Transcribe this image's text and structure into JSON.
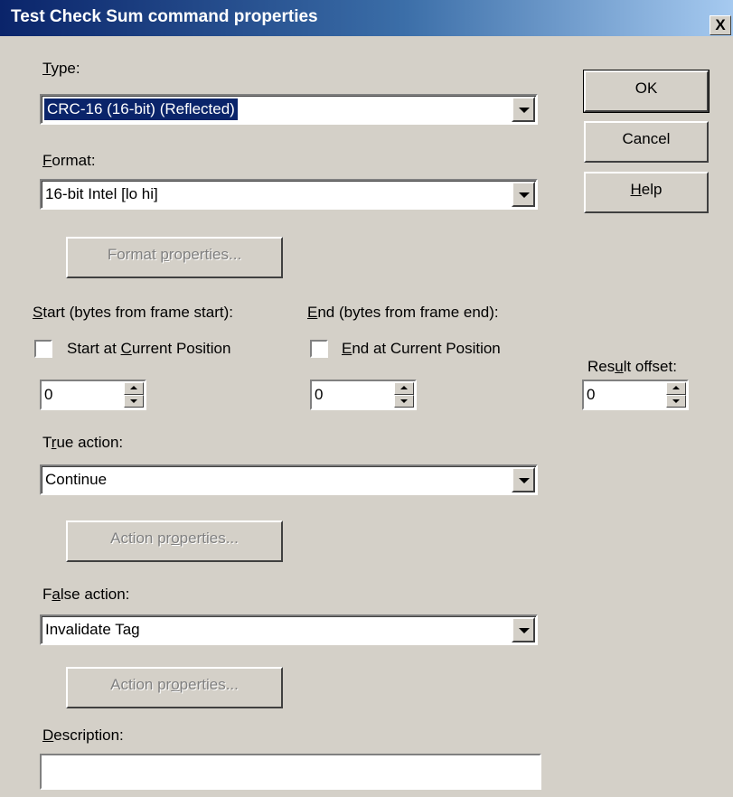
{
  "window": {
    "title": "Test Check Sum command properties",
    "close_label": "X"
  },
  "type": {
    "label_u": "T",
    "label_rest": "ype:",
    "value": "CRC-16  (16-bit) (Reflected)"
  },
  "format": {
    "label_u": "F",
    "label_rest": "ormat:",
    "value": "16-bit Intel  [lo hi]"
  },
  "format_properties": {
    "pre": "Format ",
    "u": "p",
    "post": "roperties..."
  },
  "start": {
    "label_u": "S",
    "label_rest": "tart (bytes from frame start):",
    "check_pre": "Start at ",
    "check_u": "C",
    "check_post": "urrent Position",
    "checked": false,
    "value": "0"
  },
  "end": {
    "label_u": "E",
    "label_rest": "nd (bytes from frame end):",
    "check_u": "E",
    "check_post": "nd at Current Position",
    "checked": false,
    "value": "0"
  },
  "result_offset": {
    "pre": "Res",
    "u": "u",
    "post": "lt offset:",
    "value": "0"
  },
  "true_action": {
    "pre": "T",
    "u": "r",
    "post": "ue action:",
    "value": "Continue"
  },
  "true_action_properties": {
    "pre": "Action pr",
    "u": "o",
    "post": "perties..."
  },
  "false_action": {
    "pre": "F",
    "u": "a",
    "post": "lse action:",
    "value": "Invalidate Tag"
  },
  "false_action_properties": {
    "pre": "Action pr",
    "u": "o",
    "post": "perties..."
  },
  "description": {
    "label_u": "D",
    "label_rest": "escription:",
    "value": ""
  },
  "buttons": {
    "ok": "OK",
    "cancel": "Cancel",
    "help_u": "H",
    "help_rest": "elp"
  }
}
